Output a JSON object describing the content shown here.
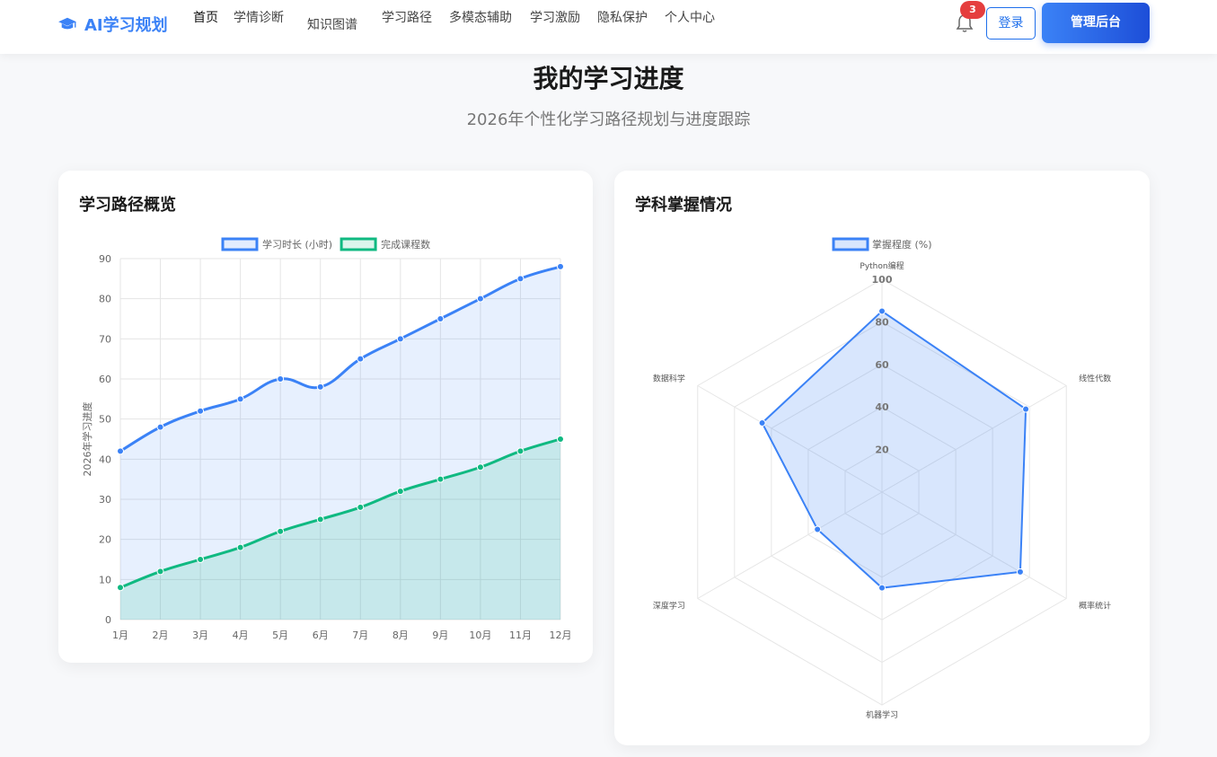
{
  "nav": {
    "logo_text": "AI学习规划",
    "menu": [
      "首页",
      "学情诊断",
      "知识图谱",
      "学习路径",
      "多模态辅助",
      "学习激励",
      "隐私保护",
      "个人中心"
    ],
    "notification_count": "3",
    "login_label": "登录",
    "admin_label": "管理后台"
  },
  "header": {
    "title": "我的学习进度",
    "subtitle": "2026年个性化学习路径规划与进度跟踪"
  },
  "colors": {
    "accent": "#3b82f6",
    "green": "#10b981",
    "badge": "#e53e3e"
  },
  "cards": {
    "path_title": "学习路径概览",
    "mastery_title": "学科掌握情况"
  },
  "chart_data": [
    {
      "type": "line",
      "title": "",
      "xlabel": "",
      "ylabel": "2026年学习进度",
      "categories": [
        "1月",
        "2月",
        "3月",
        "4月",
        "5月",
        "6月",
        "7月",
        "8月",
        "9月",
        "10月",
        "11月",
        "12月"
      ],
      "series": [
        {
          "name": "学习时长 (小时)",
          "color": "#3b82f6",
          "values": [
            42,
            48,
            52,
            55,
            60,
            58,
            65,
            70,
            75,
            80,
            85,
            88
          ]
        },
        {
          "name": "完成课程数",
          "color": "#10b981",
          "values": [
            8,
            12,
            15,
            18,
            22,
            25,
            28,
            32,
            35,
            38,
            42,
            45
          ]
        }
      ],
      "ylim": [
        0,
        90
      ],
      "yticks": [
        0,
        10,
        20,
        30,
        40,
        50,
        60,
        70,
        80,
        90
      ],
      "grid": true,
      "legend": "top"
    },
    {
      "type": "radar",
      "title": "",
      "categories": [
        "Python编程",
        "线性代数",
        "概率统计",
        "机器学习",
        "深度学习",
        "数据科学"
      ],
      "series": [
        {
          "name": "掌握程度 (%)",
          "color": "#3b82f6",
          "values": [
            85,
            78,
            75,
            45,
            35,
            65
          ]
        }
      ],
      "rlim": [
        0,
        100
      ],
      "rticks": [
        20,
        40,
        60,
        80,
        100
      ],
      "grid": true,
      "legend": "top"
    }
  ]
}
